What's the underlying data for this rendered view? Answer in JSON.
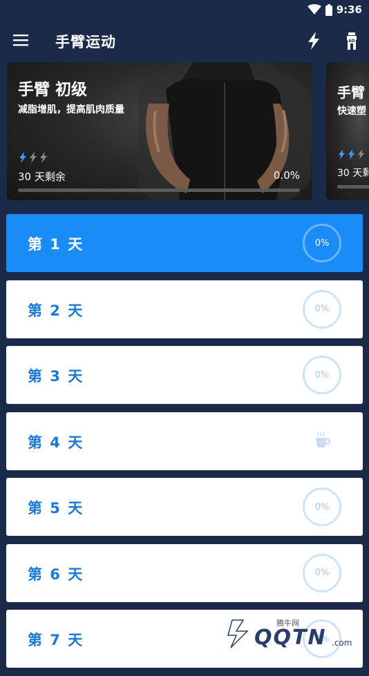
{
  "status": {
    "time": "9:36"
  },
  "header": {
    "title": "手臂运动"
  },
  "program": {
    "title": "手臂 初级",
    "subtitle": "减脂增肌，提高肌肉质量",
    "days_left": "30 天剩余",
    "progress": "0.0%",
    "progress_value": 0,
    "level": 1
  },
  "program_next": {
    "title": "手臂",
    "subtitle": "快速塑",
    "days_left": "30 天剩",
    "level": 2
  },
  "days": [
    {
      "label": "第 1 天",
      "value": "0%"
    },
    {
      "label": "第 2 天",
      "value": "0%"
    },
    {
      "label": "第 3 天",
      "value": "0%"
    },
    {
      "label": "第 4 天",
      "value": ""
    },
    {
      "label": "第 5 天",
      "value": "0%"
    },
    {
      "label": "第 6 天",
      "value": "0%"
    },
    {
      "label": "第 7 天",
      "value": "0%"
    }
  ],
  "watermark": {
    "small": "腾牛网",
    "big": "QQTN",
    "suffix": ".com"
  },
  "colors": {
    "background": "#1b2a48",
    "accent": "#1a8cf7",
    "day_text": "#1a79d6",
    "bolt_active": "#3fa0ff"
  },
  "icons": [
    "menu-icon",
    "wifi-icon",
    "battery-icon",
    "bolt-icon",
    "ad-icon",
    "coffee-icon"
  ]
}
